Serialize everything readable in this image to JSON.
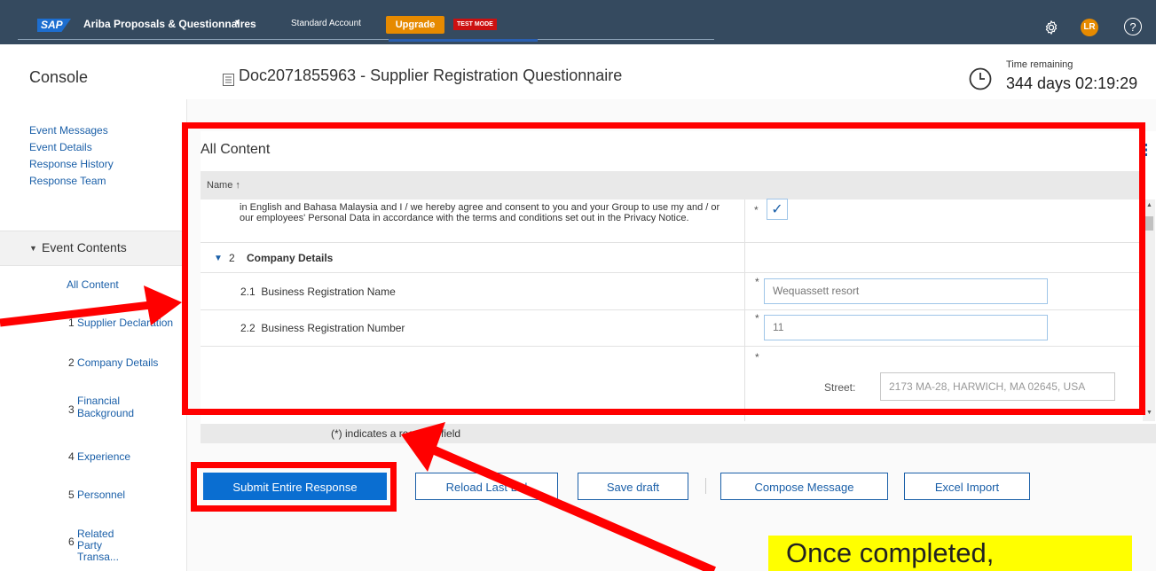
{
  "topbar": {
    "logo": "SAP",
    "app_title": "Ariba Proposals & Questionnaires",
    "app_caret": "▾",
    "account": "Standard Account",
    "upgrade": "Upgrade",
    "test_mode": "TEST MODE",
    "avatar": "LR",
    "help": "?"
  },
  "header": {
    "console": "Console",
    "doc_title": "Doc2071855963 - Supplier Registration Questionnaire",
    "time_label": "Time remaining",
    "time_value": "344 days 02:19:29"
  },
  "leftnav": {
    "links": [
      "Event Messages",
      "Event Details",
      "Response History",
      "Response Team"
    ],
    "event_contents": "Event Contents",
    "items": [
      {
        "num": "",
        "label": "All Content"
      },
      {
        "num": "1",
        "label": "Supplier Declaration"
      },
      {
        "num": "2",
        "label": "Company Details"
      },
      {
        "num": "3",
        "label": "Financial Background"
      },
      {
        "num": "4",
        "label": "Experience"
      },
      {
        "num": "5",
        "label": "Personnel"
      },
      {
        "num": "6",
        "label": "Related Party Transa..."
      }
    ]
  },
  "panel": {
    "title": "All Content",
    "column_name": "Name ↑",
    "privacy_text": "in English and Bahasa Malaysia and I / we hereby agree and consent to you and your Group to use my and / or our employees' Personal Data in accordance with the terms and conditions set out in the Privacy Notice.",
    "checkmark": "✓",
    "required_mark": "*",
    "section": {
      "num": "2",
      "title": "Company Details"
    },
    "questions": [
      {
        "num": "2.1",
        "label": "Business Registration Name",
        "value": "Wequassett resort"
      },
      {
        "num": "2.2",
        "label": "Business Registration Number",
        "value": "11"
      }
    ],
    "street_label": "Street:",
    "street_value": "2173 MA-28, HARWICH, MA 02645, USA",
    "footer_note": "(*) indicates a required field"
  },
  "buttons": {
    "submit": "Submit Entire Response",
    "reload": "Reload Last Bid",
    "save": "Save draft",
    "compose": "Compose Message",
    "excel": "Excel Import"
  },
  "annotation": {
    "callout": "Once completed,",
    "color": "#ff0000"
  }
}
